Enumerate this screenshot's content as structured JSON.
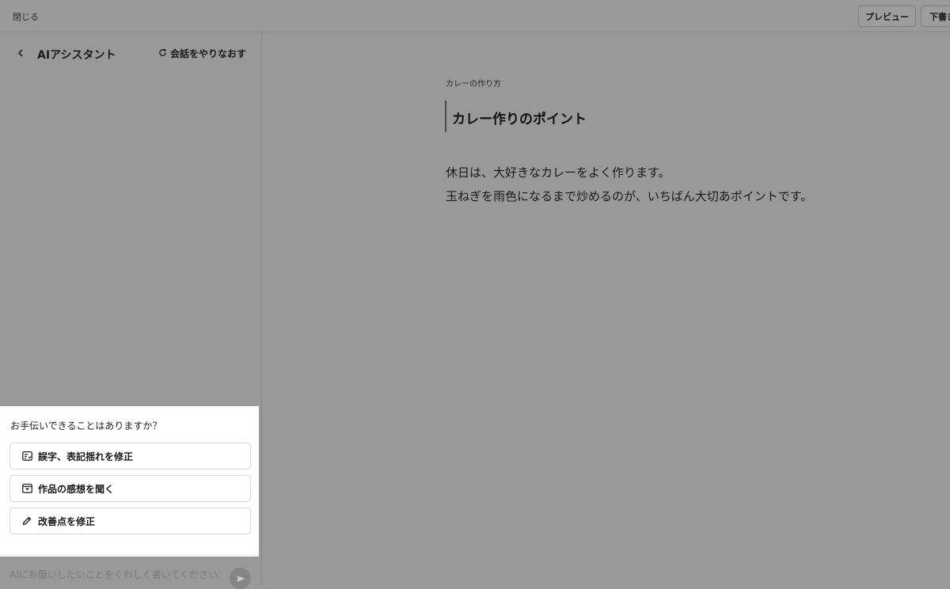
{
  "topbar": {
    "close_label": "閉じる",
    "preview_label": "プレビュー",
    "draft_label": "下書き"
  },
  "assistant": {
    "title": "AIアシスタント",
    "reset_label": "会話をやりなおす",
    "prompt": "お手伝いできることはありますか？",
    "options": [
      {
        "label": "誤字、表記揺れを修正",
        "icon": "spellcheck-icon"
      },
      {
        "label": "作品の感想を聞く",
        "icon": "inbox-icon"
      },
      {
        "label": "改善点を修正",
        "icon": "pencil-icon"
      }
    ],
    "input_placeholder": "AIにお願いしたいことをくわしく書いてください"
  },
  "editor": {
    "doc_title": "カレーの作り方",
    "heading": "カレー作りのポイント",
    "paragraphs": [
      "休日は、大好きなカレーをよく作ります。",
      "玉ねぎを雨色になるまで炒めるのが、いちばん大切あポイントです。"
    ]
  }
}
